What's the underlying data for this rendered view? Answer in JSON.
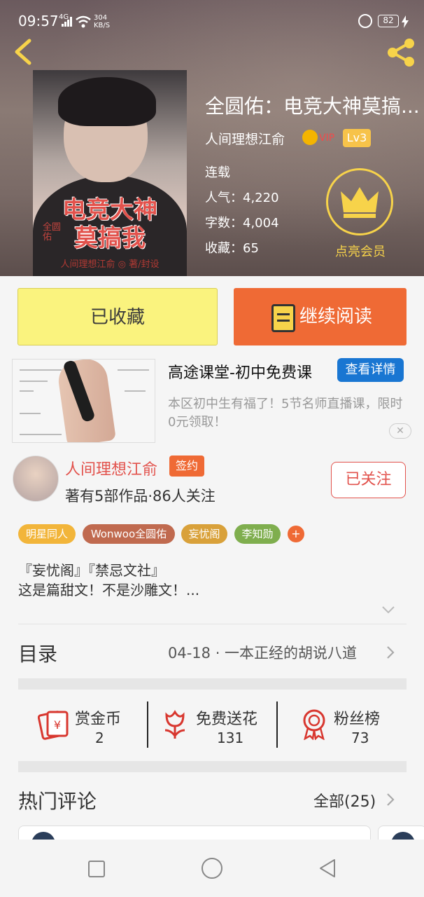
{
  "status_bar": {
    "time": "09:57",
    "network": "4G",
    "speed": "304",
    "speed_unit": "KB/S",
    "battery": "82"
  },
  "book": {
    "title": "全圆佑：电竞大神莫搞...",
    "author": "人间理想江俞",
    "vip": "VIP",
    "level": "Lv3",
    "status": "连载",
    "popularity_label": "人气：",
    "popularity": "4,220",
    "words_label": "字数：",
    "words": "4,004",
    "collect_label": "收藏：",
    "collect": "65",
    "member_label": "点亮会员",
    "cover": {
      "title_line1": "电竞大神",
      "title_line2": "莫搞我",
      "side": "全圆佑",
      "credit": "人间理想江俞 ◎ 著/封设"
    }
  },
  "actions": {
    "favorited": "已收藏",
    "continue_reading": "继续阅读"
  },
  "ad": {
    "title": "高途课堂-初中免费课",
    "button": "查看详情",
    "description": "本区初中生有福了！5节名师直播课，限时0元领取！",
    "close": "✕"
  },
  "author_info": {
    "name": "人间理想江俞",
    "badge": "签约",
    "meta": "著有5部作品·86人关注",
    "follow": "已关注"
  },
  "tags": [
    {
      "label": "明星同人",
      "color": "#f2b53a"
    },
    {
      "label": "Wonwoo全圆佑",
      "color": "#c06a4f"
    },
    {
      "label": "妄忧阁",
      "color": "#d9a13a"
    },
    {
      "label": "李知勋",
      "color": "#7fae4e"
    }
  ],
  "tag_more": "+",
  "intro": {
    "line1": "『妄忧阁』『禁忌文社』",
    "line2": "这是篇甜文！不是沙雕文！..."
  },
  "toc": {
    "label": "目录",
    "latest": "04-18 · 一本正经的胡说八道"
  },
  "stats": [
    {
      "label": "赏金币",
      "value": "2",
      "icon": "money-envelope-icon"
    },
    {
      "label": "免费送花",
      "value": "131",
      "icon": "flower-icon"
    },
    {
      "label": "粉丝榜",
      "value": "73",
      "icon": "medal-icon"
    }
  ],
  "comments": {
    "label": "热门评论",
    "all": "全部(25)"
  },
  "colors": {
    "accent": "#ef6a35",
    "red": "#e2524c",
    "yellow": "#faf37e",
    "gold": "#f7d34a",
    "blue": "#1976d2"
  }
}
